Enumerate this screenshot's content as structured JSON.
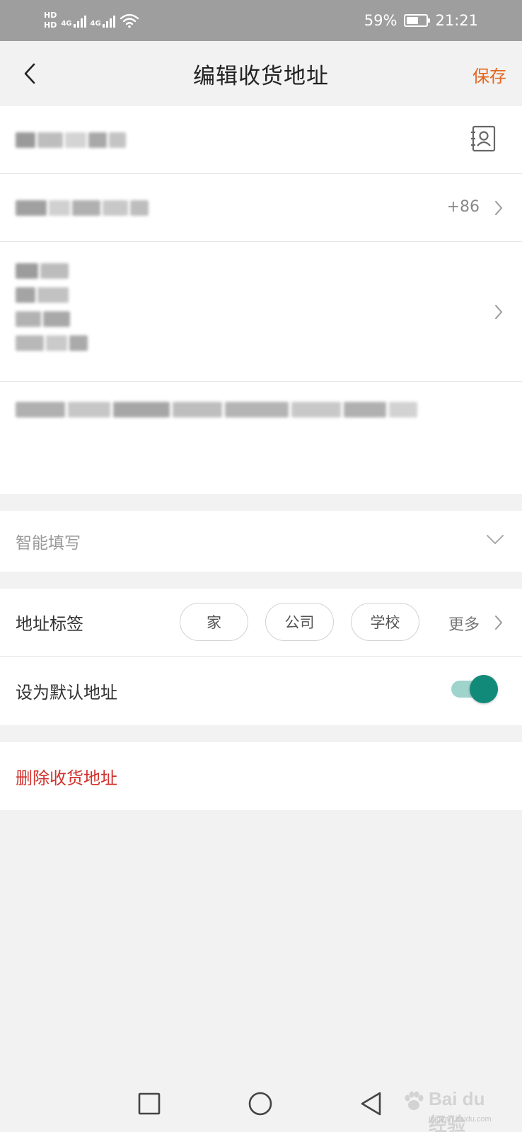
{
  "status_bar": {
    "hd1": "HD",
    "hd2": "HD",
    "net1": "4G",
    "net2": "4G",
    "battery_percent": "59%",
    "battery_level": 0.59,
    "time": "21:21"
  },
  "header": {
    "title": "编辑收货地址",
    "save_label": "保存"
  },
  "form": {
    "country_code": "+86"
  },
  "smart_fill": {
    "label": "智能填写"
  },
  "tags": {
    "label": "地址标签",
    "options": [
      "家",
      "公司",
      "学校"
    ],
    "more_label": "更多"
  },
  "default_address": {
    "label": "设为默认地址",
    "enabled": true
  },
  "delete": {
    "label": "删除收货地址"
  },
  "watermark": {
    "main": "Bai du 经验",
    "sub": "jingyan.baidu.com"
  },
  "colors": {
    "accent": "#e5651f",
    "danger": "#d0312d",
    "toggle_on": "#128a7a"
  }
}
